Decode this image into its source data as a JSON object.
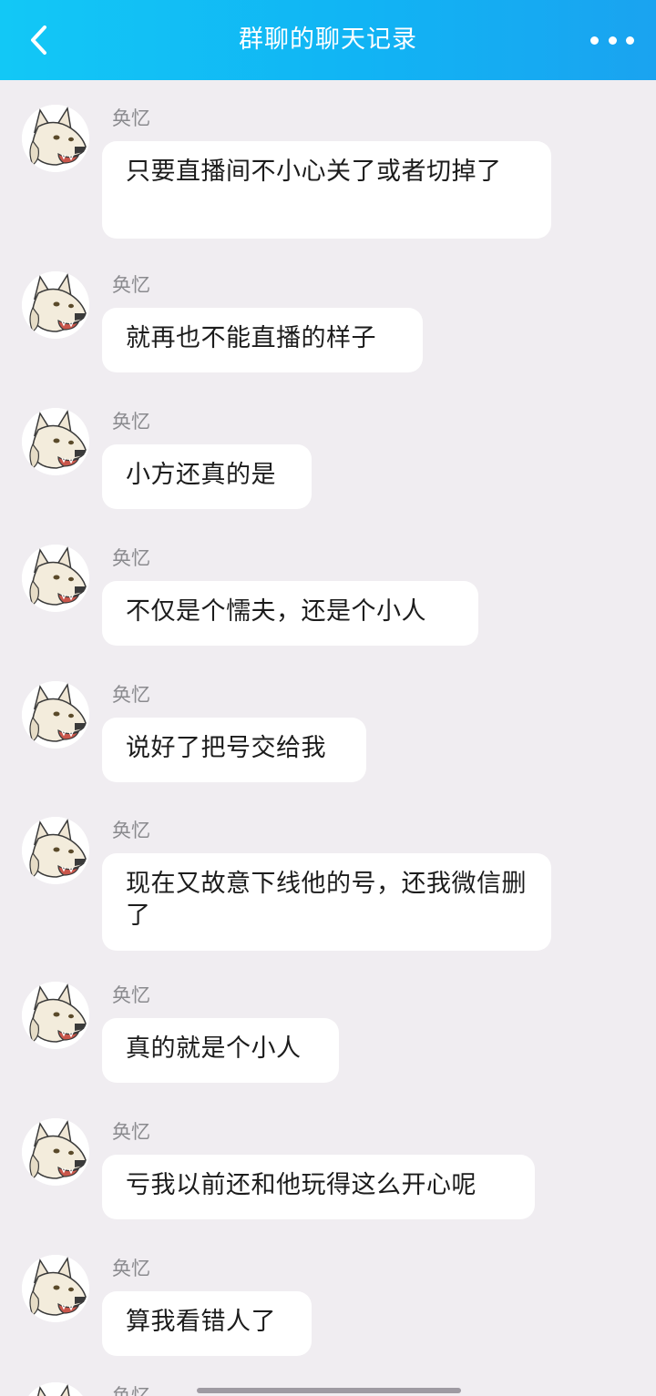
{
  "header": {
    "title": "群聊的聊天记录",
    "back_icon": "chevron-left-icon",
    "more_icon": "more-dots-icon",
    "background": "#11b4f4"
  },
  "messages": [
    {
      "sender": "奂忆",
      "text": "只要直播间不小心关了或者切掉了",
      "multiline": true
    },
    {
      "sender": "奂忆",
      "text": "就再也不能直播的样子",
      "multiline": false
    },
    {
      "sender": "奂忆",
      "text": "小方还真的是",
      "multiline": false
    },
    {
      "sender": "奂忆",
      "text": "不仅是个懦夫，还是个小人",
      "multiline": false
    },
    {
      "sender": "奂忆",
      "text": "说好了把号交给我",
      "multiline": false
    },
    {
      "sender": "奂忆",
      "text": "现在又故意下线他的号，还我微信删了",
      "multiline": true
    },
    {
      "sender": "奂忆",
      "text": "真的就是个小人",
      "multiline": false
    },
    {
      "sender": "奂忆",
      "text": "亏我以前还和他玩得这么开心呢",
      "multiline": false
    },
    {
      "sender": "奂忆",
      "text": "算我看错人了",
      "multiline": false
    },
    {
      "sender": "奂忆",
      "text": "",
      "multiline": false
    }
  ],
  "colors": {
    "chat_background": "#f0edf1",
    "bubble": "#ffffff",
    "sender_name": "#8a8a8e"
  }
}
